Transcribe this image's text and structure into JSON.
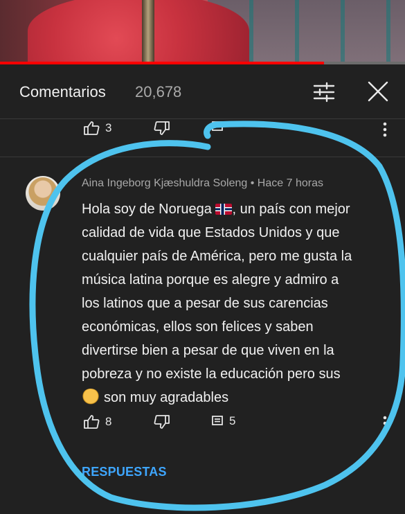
{
  "video": {
    "progress_fraction": 0.8
  },
  "header": {
    "title": "Comentarios",
    "count": "20,678",
    "filter_icon": "sort-sliders-icon",
    "close_icon": "close-icon"
  },
  "previous_comment": {
    "likes": "3"
  },
  "comment": {
    "author": "Aina Ingeborg Kjæshuldra Soleng",
    "separator": "•",
    "time": "Hace 7 horas",
    "lines": [
      "Hola soy de Noruega",
      ", un país con mejor",
      "calidad de vida que Estados Unidos y que",
      "cualquier país de América, pero me gusta la",
      "música latina porque es alegre y admiro a",
      "los latinos que a pesar de sus carencias",
      "económicas, ellos son felices y saben",
      "divertirse bien a pesar de que viven en la",
      "pobreza y no existe la educación pero sus",
      "son muy agradables"
    ],
    "likes": "8",
    "replies_count": "5",
    "replies_label": "RESPUESTAS"
  },
  "colors": {
    "background": "#212121",
    "accent_link": "#3ea6ff",
    "annotation_stroke": "#4ec3ee"
  }
}
